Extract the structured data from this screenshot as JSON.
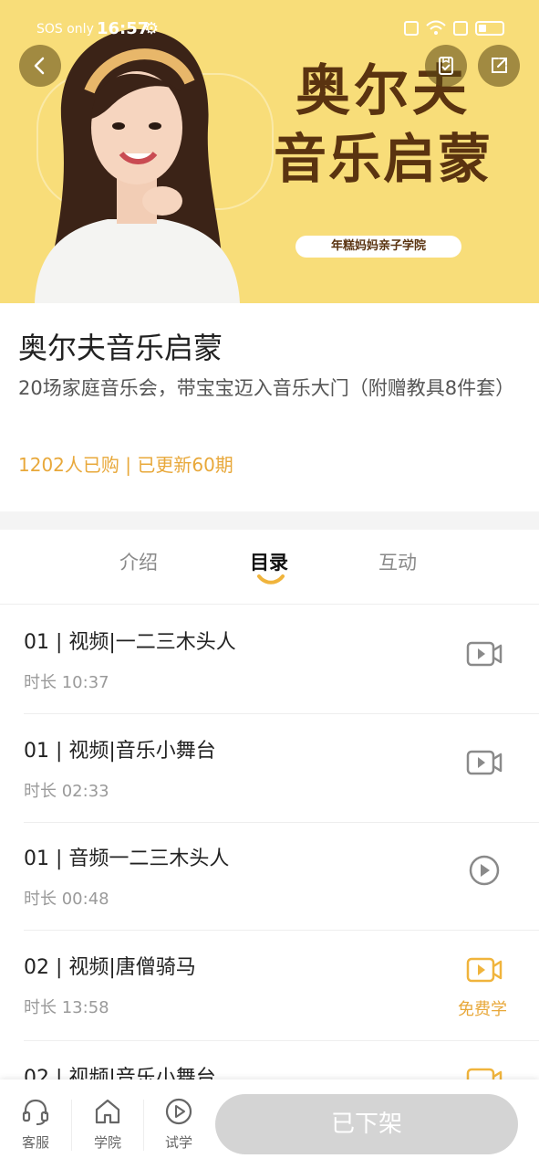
{
  "status_bar": {
    "carrier": "SOS only",
    "time": "16:57"
  },
  "banner": {
    "title_line1": "奥尔夫",
    "title_line2": "音乐启蒙",
    "pill": "年糕妈妈亲子学院",
    "bg_color": "#f8dd79"
  },
  "header_buttons": {
    "back_icon": "chevron-left-icon",
    "save_icon": "bookmark-check-icon",
    "share_icon": "share-icon"
  },
  "course": {
    "title": "奥尔夫音乐启蒙",
    "subtitle": "20场家庭音乐会，带宝宝迈入音乐大门（附赠教具8件套）",
    "stats": "1202人已购 | 已更新60期",
    "accent_color": "#e8a83a"
  },
  "tabs": [
    {
      "label": "介绍"
    },
    {
      "label": "目录"
    },
    {
      "label": "互动"
    }
  ],
  "lessons": [
    {
      "title": "01 | 视频|一二三木头人",
      "duration": "时长 10:37",
      "icon": "video-icon",
      "free": ""
    },
    {
      "title": "01 | 视频|音乐小舞台",
      "duration": "时长 02:33",
      "icon": "video-icon",
      "free": ""
    },
    {
      "title": "01 | 音频一二三木头人",
      "duration": "时长 00:48",
      "icon": "play-circle-icon",
      "free": ""
    },
    {
      "title": "02 | 视频|唐僧骑马",
      "duration": "时长 13:58",
      "icon": "video-icon",
      "free": "免费学"
    },
    {
      "title": "02 | 视频|音乐小舞台",
      "duration": "",
      "icon": "video-icon",
      "free": ""
    }
  ],
  "bottom_bar": {
    "service": "客服",
    "academy": "学院",
    "trial": "试学",
    "buy_button": "已下架"
  }
}
